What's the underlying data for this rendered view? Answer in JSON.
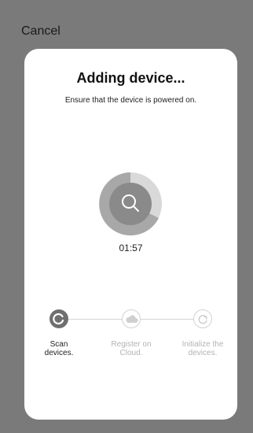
{
  "header": {
    "cancel_label": "Cancel"
  },
  "card": {
    "title": "Adding device...",
    "subtitle": "Ensure that the device is powered on.",
    "timer": "01:57"
  },
  "steps": [
    {
      "label_line1": "Scan",
      "label_line2": "devices.",
      "state": "active"
    },
    {
      "label_line1": "Register on",
      "label_line2": "Cloud.",
      "state": "pending"
    },
    {
      "label_line1": "Initialize the",
      "label_line2": "devices.",
      "state": "pending"
    }
  ],
  "colors": {
    "overlay": "#7a7a7a",
    "card": "#ffffff",
    "active": "#6f6f6f",
    "inactive": "#d2d2d2"
  },
  "icons": [
    "search-icon",
    "refresh-icon",
    "cloud-icon",
    "restart-icon"
  ]
}
